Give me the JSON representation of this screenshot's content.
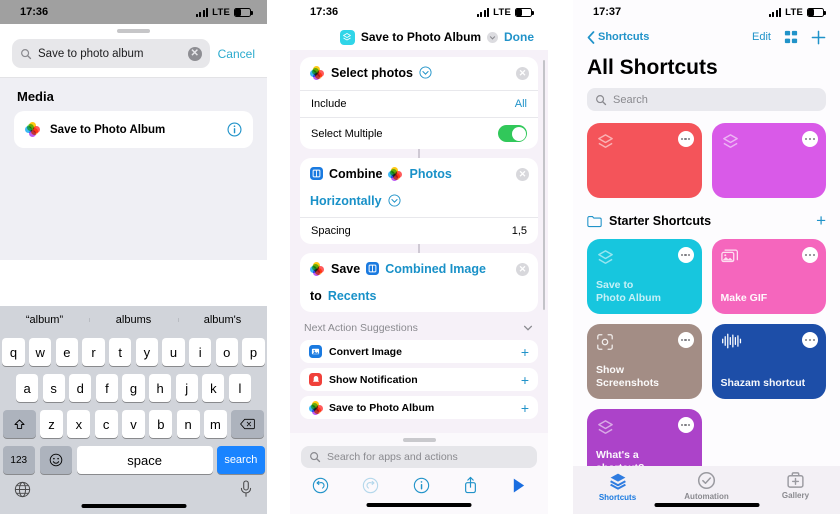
{
  "panel1": {
    "status": {
      "time": "17:36",
      "network": "LTE"
    },
    "search": {
      "value": "Save to photo album",
      "clear_label": "✕",
      "cancel_label": "Cancel",
      "icon": "search-icon"
    },
    "section_title": "Media",
    "result": {
      "label": "Save to Photo Album",
      "icon": "photos-app-icon",
      "info_icon": "info-icon"
    },
    "keyboard": {
      "predictions": [
        "“album”",
        "albums",
        "album's"
      ],
      "row1": [
        "q",
        "w",
        "e",
        "r",
        "t",
        "y",
        "u",
        "i",
        "o",
        "p"
      ],
      "row2": [
        "a",
        "s",
        "d",
        "f",
        "g",
        "h",
        "j",
        "k",
        "l"
      ],
      "row3": [
        "z",
        "x",
        "c",
        "v",
        "b",
        "n",
        "m"
      ],
      "shift_icon": "shift-icon",
      "backspace_icon": "backspace-icon",
      "numeric_label": "123",
      "emoji_icon": "emoji-icon",
      "space_label": "space",
      "return_label": "search",
      "globe_icon": "globe-icon",
      "mic_icon": "microphone-icon"
    }
  },
  "panel2": {
    "status": {
      "time": "17:36",
      "network": "LTE"
    },
    "nav": {
      "title": "Save to Photo Album",
      "done_label": "Done",
      "app_icon": "shortcuts-icon",
      "chevron_icon": "chevron-down-icon"
    },
    "actions": [
      {
        "title_tokens": [
          {
            "text": "Select photos",
            "style": "plain"
          }
        ],
        "icon": "photos-app-icon",
        "has_chevron": true,
        "close_icon": "close-icon",
        "rows": [
          {
            "key": "Include",
            "value": "All",
            "type": "value"
          },
          {
            "key": "Select Multiple",
            "value": "on",
            "type": "toggle"
          }
        ]
      },
      {
        "title_tokens": [
          {
            "text": "Combine",
            "style": "plain"
          },
          {
            "text": "Photos",
            "style": "link"
          },
          {
            "text": "Horizontally",
            "style": "link"
          }
        ],
        "icon": "combine-icon",
        "has_chevron": true,
        "close_icon": "close-icon",
        "rows": [
          {
            "key": "Spacing",
            "value": "1,5",
            "type": "plainvalue"
          }
        ]
      },
      {
        "title_tokens": [
          {
            "text": "Save",
            "style": "plain"
          },
          {
            "text": "Combined Image",
            "style": "link"
          },
          {
            "text": "to",
            "style": "plain"
          },
          {
            "text": "Recents",
            "style": "link"
          }
        ],
        "icon": "photos-app-icon",
        "has_chevron": false,
        "close_icon": "close-icon",
        "rows": []
      }
    ],
    "suggestions_header": {
      "label": "Next Action Suggestions",
      "chevron_icon": "chevron-down-icon"
    },
    "suggestions": [
      {
        "label": "Convert Image",
        "icon": "convert-image-icon",
        "add_label": "+"
      },
      {
        "label": "Show Notification",
        "icon": "notification-icon",
        "add_label": "+"
      },
      {
        "label": "Save to Photo Album",
        "icon": "photos-app-icon",
        "add_label": "+"
      }
    ],
    "action_search": {
      "placeholder": "Search for apps and actions",
      "icon": "search-icon"
    },
    "toolbar": [
      {
        "name": "undo-icon",
        "state": "enabled"
      },
      {
        "name": "redo-icon",
        "state": "disabled"
      },
      {
        "name": "info-icon",
        "state": "enabled"
      },
      {
        "name": "share-icon",
        "state": "enabled"
      },
      {
        "name": "play-icon",
        "state": "enabled"
      }
    ]
  },
  "panel3": {
    "status": {
      "time": "17:37",
      "network": "LTE"
    },
    "nav": {
      "back_label": "Shortcuts",
      "edit_label": "Edit",
      "grid_icon": "grid-view-icon",
      "add_label": "+"
    },
    "title": "All Shortcuts",
    "search": {
      "placeholder": "Search",
      "icon": "search-icon"
    },
    "top_tiles": [
      {
        "name": "",
        "color": "#f4545a",
        "icon": "shortcuts-icon",
        "menu_icon": "more-icon"
      },
      {
        "name": "",
        "color": "#d95ae8",
        "icon": "shortcuts-icon",
        "menu_icon": "more-icon"
      }
    ],
    "folder": {
      "label": "Starter Shortcuts",
      "icon": "folder-icon",
      "add_label": "+"
    },
    "folder_tiles": [
      {
        "name": "Save to\nPhoto Album",
        "color": "#17c6de",
        "icon": "shortcuts-icon",
        "menu_icon": "more-icon"
      },
      {
        "name": "Make GIF",
        "color": "#f566bd",
        "icon": "gif-icon",
        "menu_icon": "more-icon"
      },
      {
        "name": "Show\nScreenshots",
        "color": "#a38d85",
        "icon": "screenshot-icon",
        "menu_icon": "more-icon"
      },
      {
        "name": "Shazam shortcut",
        "color": "#1d4ea8",
        "icon": "waveform-icon",
        "menu_icon": "more-icon"
      },
      {
        "name": "What's a\nshortcut?",
        "color": "#ac43c9",
        "icon": "shortcuts-icon",
        "menu_icon": "more-icon"
      }
    ],
    "tabs": [
      {
        "label": "Shortcuts",
        "icon": "shortcuts-tab-icon",
        "active": true
      },
      {
        "label": "Automation",
        "icon": "automation-tab-icon",
        "active": false
      },
      {
        "label": "Gallery",
        "icon": "gallery-tab-icon",
        "active": false
      }
    ]
  },
  "colors": {
    "accent_blue": "#2193c9",
    "link_blue": "#1991c8",
    "toggle_green": "#31c85a",
    "key_blue": "#1a84ff"
  }
}
